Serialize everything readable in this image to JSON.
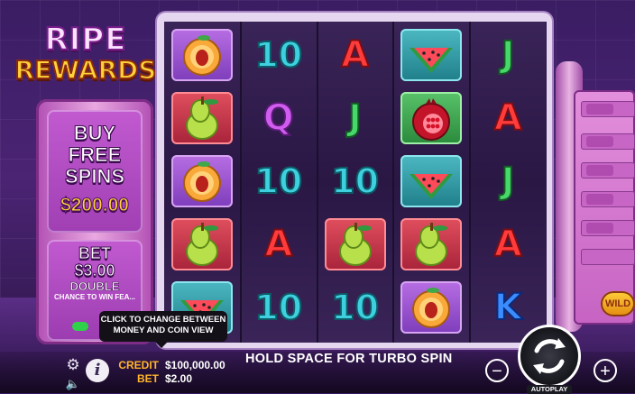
{
  "logo": {
    "line1": "RIPE",
    "line2": "REWARDS"
  },
  "buy_feature": {
    "label": "BUY FREE SPINS",
    "price": "$200.00"
  },
  "double_bet": {
    "title": "BET",
    "amount": "$3.00",
    "mode": "DOUBLE",
    "subtext": "CHANCE TO WIN FEA..."
  },
  "reels": [
    [
      {
        "symbol": "peach",
        "tile": "purple"
      },
      {
        "symbol": "pear",
        "tile": "red"
      },
      {
        "symbol": "peach",
        "tile": "purple"
      },
      {
        "symbol": "pear",
        "tile": "red"
      },
      {
        "symbol": "watermelon",
        "tile": "teal"
      }
    ],
    [
      {
        "symbol": "10"
      },
      {
        "symbol": "Q"
      },
      {
        "symbol": "10"
      },
      {
        "symbol": "A"
      },
      {
        "symbol": "10"
      }
    ],
    [
      {
        "symbol": "A"
      },
      {
        "symbol": "J"
      },
      {
        "symbol": "10"
      },
      {
        "symbol": "pear",
        "tile": "red"
      },
      {
        "symbol": "10"
      }
    ],
    [
      {
        "symbol": "watermelon",
        "tile": "teal"
      },
      {
        "symbol": "pomegranate",
        "tile": "green"
      },
      {
        "symbol": "watermelon",
        "tile": "teal"
      },
      {
        "symbol": "pear",
        "tile": "red"
      },
      {
        "symbol": "peach",
        "tile": "purple"
      }
    ],
    [
      {
        "symbol": "J"
      },
      {
        "symbol": "A"
      },
      {
        "symbol": "J"
      },
      {
        "symbol": "A"
      },
      {
        "symbol": "K"
      }
    ]
  ],
  "wild_badge": "WILD",
  "tooltip": {
    "line1": "CLICK TO CHANGE BETWEEN",
    "line2": "MONEY AND COIN VIEW"
  },
  "balance": {
    "credit_label": "CREDIT",
    "credit_value": "$100,000.00",
    "bet_label": "BET",
    "bet_value": "$2.00"
  },
  "message": "HOLD SPACE FOR TURBO SPIN",
  "controls": {
    "minus": "−",
    "plus": "+",
    "autoplay": "AUTOPLAY",
    "settings_icon": "gear-icon",
    "sound_icon": "speaker-icon",
    "info_icon": "info-icon",
    "info": "i"
  },
  "colors": {
    "credit_label": "#ffb52a",
    "background": "#3a1d63"
  }
}
